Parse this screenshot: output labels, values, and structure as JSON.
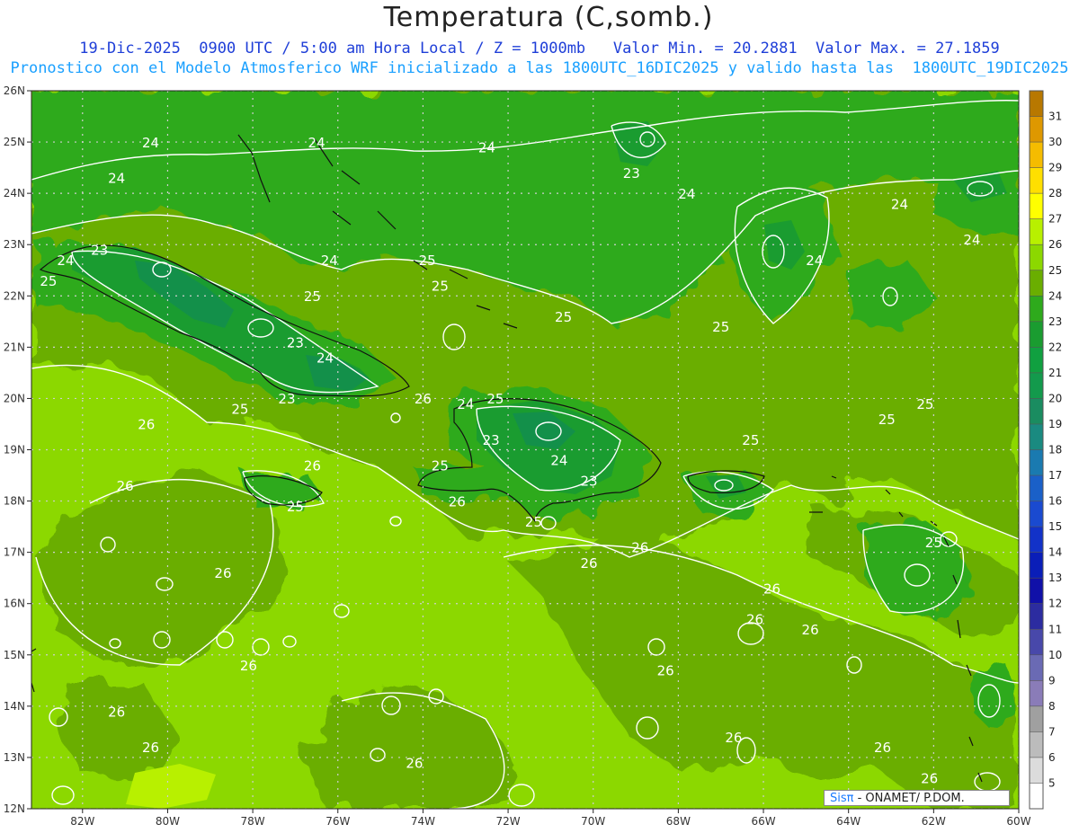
{
  "title": "Temperatura (C,somb.)",
  "subtitle_line1": "19-Dic-2025  0900 UTC / 5:00 am Hora Local / Z = 1000mb   Valor Min. = 20.2881  Valor Max. = 27.1859",
  "subtitle_line2": "Pronostico con el Modelo Atmosferico WRF inicializado a las 1800UTC_16DIC2025 y valido hasta las  1800UTC_19DIC2025",
  "credit": {
    "sis": "Sisπ",
    "rest": "- ONAMET/  P.DOM."
  },
  "chart_data": {
    "type": "heatmap",
    "variable": "Temperatura (C,somb.)",
    "lon_range": [
      -83.2,
      -60
    ],
    "lat_range": [
      12,
      26
    ],
    "x_ticks": [
      "82W",
      "80W",
      "78W",
      "76W",
      "74W",
      "72W",
      "70W",
      "68W",
      "66W",
      "64W",
      "62W",
      "60W"
    ],
    "y_ticks": [
      "26N",
      "25N",
      "24N",
      "23N",
      "22N",
      "21N",
      "20N",
      "19N",
      "18N",
      "17N",
      "16N",
      "15N",
      "14N",
      "13N",
      "12N"
    ],
    "colorbar": {
      "labels": [
        31,
        30,
        29,
        28,
        27,
        26,
        25,
        24,
        23,
        22,
        21,
        20,
        19,
        18,
        17,
        16,
        15,
        14,
        13,
        12,
        11,
        10,
        9,
        8,
        7,
        6,
        5
      ],
      "colors": [
        "#b87800",
        "#de9800",
        "#f5bc00",
        "#ffdf00",
        "#ffff00",
        "#b8f000",
        "#8cd800",
        "#6aae00",
        "#2eaa1c",
        "#1a9c30",
        "#10a040",
        "#139a4c",
        "#1a8c60",
        "#1a8a80",
        "#1a7ab0",
        "#1a60c8",
        "#1a4ad0",
        "#1232c8",
        "#0a1eb8",
        "#1010a8",
        "#2c2ca0",
        "#4848aa",
        "#6a6ab4",
        "#8a7cb8",
        "#a0a0a0",
        "#bcbcbc",
        "#dcdcdc",
        "#ffffff"
      ]
    },
    "contour_labels": [
      {
        "value": "24",
        "lon": -80.4,
        "lat": 24.9
      },
      {
        "value": "24",
        "lon": -76.5,
        "lat": 24.9
      },
      {
        "value": "24",
        "lon": -72.5,
        "lat": 24.8
      },
      {
        "value": "23",
        "lon": -69.1,
        "lat": 24.3
      },
      {
        "value": "24",
        "lon": -81.2,
        "lat": 24.2
      },
      {
        "value": "24",
        "lon": -67.8,
        "lat": 23.9
      },
      {
        "value": "24",
        "lon": -62.8,
        "lat": 23.7
      },
      {
        "value": "24",
        "lon": -61.1,
        "lat": 23.0
      },
      {
        "value": "23",
        "lon": -81.6,
        "lat": 22.8
      },
      {
        "value": "24",
        "lon": -82.4,
        "lat": 22.6
      },
      {
        "value": "24",
        "lon": -76.2,
        "lat": 22.6
      },
      {
        "value": "25",
        "lon": -73.9,
        "lat": 22.6
      },
      {
        "value": "24",
        "lon": -64.8,
        "lat": 22.6
      },
      {
        "value": "25",
        "lon": -82.8,
        "lat": 22.2
      },
      {
        "value": "25",
        "lon": -73.6,
        "lat": 22.1
      },
      {
        "value": "25",
        "lon": -76.6,
        "lat": 21.9
      },
      {
        "value": "25",
        "lon": -70.7,
        "lat": 21.5
      },
      {
        "value": "25",
        "lon": -67.0,
        "lat": 21.3
      },
      {
        "value": "23",
        "lon": -77.0,
        "lat": 21.0
      },
      {
        "value": "24",
        "lon": -76.3,
        "lat": 20.7
      },
      {
        "value": "26",
        "lon": -74.0,
        "lat": 19.9
      },
      {
        "value": "23",
        "lon": -77.2,
        "lat": 19.9
      },
      {
        "value": "25",
        "lon": -72.3,
        "lat": 19.9
      },
      {
        "value": "25",
        "lon": -62.2,
        "lat": 19.8
      },
      {
        "value": "25",
        "lon": -78.3,
        "lat": 19.7
      },
      {
        "value": "24",
        "lon": -73.0,
        "lat": 19.8
      },
      {
        "value": "25",
        "lon": -63.1,
        "lat": 19.5
      },
      {
        "value": "26",
        "lon": -80.5,
        "lat": 19.4
      },
      {
        "value": "23",
        "lon": -72.4,
        "lat": 19.1
      },
      {
        "value": "25",
        "lon": -66.3,
        "lat": 19.1
      },
      {
        "value": "24",
        "lon": -70.8,
        "lat": 18.7
      },
      {
        "value": "25",
        "lon": -73.6,
        "lat": 18.6
      },
      {
        "value": "26",
        "lon": -76.6,
        "lat": 18.6
      },
      {
        "value": "23",
        "lon": -70.1,
        "lat": 18.3
      },
      {
        "value": "26",
        "lon": -81.0,
        "lat": 18.2
      },
      {
        "value": "25",
        "lon": -77.0,
        "lat": 17.8
      },
      {
        "value": "26",
        "lon": -73.2,
        "lat": 17.9
      },
      {
        "value": "25",
        "lon": -71.4,
        "lat": 17.5
      },
      {
        "value": "25",
        "lon": -62.0,
        "lat": 17.1
      },
      {
        "value": "26",
        "lon": -68.9,
        "lat": 17.0
      },
      {
        "value": "26",
        "lon": -70.1,
        "lat": 16.7
      },
      {
        "value": "26",
        "lon": -78.7,
        "lat": 16.5
      },
      {
        "value": "26",
        "lon": -65.8,
        "lat": 16.2
      },
      {
        "value": "26",
        "lon": -66.2,
        "lat": 15.6
      },
      {
        "value": "26",
        "lon": -64.9,
        "lat": 15.4
      },
      {
        "value": "26",
        "lon": -78.1,
        "lat": 14.7
      },
      {
        "value": "26",
        "lon": -68.3,
        "lat": 14.6
      },
      {
        "value": "26",
        "lon": -81.2,
        "lat": 13.8
      },
      {
        "value": "26",
        "lon": -66.7,
        "lat": 13.3
      },
      {
        "value": "26",
        "lon": -80.4,
        "lat": 13.1
      },
      {
        "value": "26",
        "lon": -63.2,
        "lat": 13.1
      },
      {
        "value": "26",
        "lon": -74.2,
        "lat": 12.8
      },
      {
        "value": "26",
        "lon": -62.1,
        "lat": 12.5
      }
    ]
  }
}
